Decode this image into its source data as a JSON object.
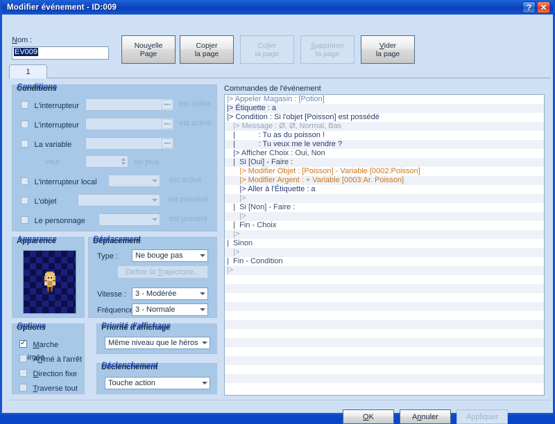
{
  "window": {
    "title": "Modifier événement - ID:009",
    "help_button": "?",
    "close_button": "✕"
  },
  "name_section": {
    "label": "Nom :",
    "label_mnemonic": "N",
    "value": "EV009"
  },
  "page_buttons": [
    {
      "line1": "Nouvelle",
      "line2": "Page",
      "mnemonic": "v",
      "enabled": true
    },
    {
      "line1": "Copier",
      "line2": "la page",
      "mnemonic": "i",
      "enabled": true
    },
    {
      "line1": "Coller",
      "line2": "la page",
      "mnemonic": "l",
      "enabled": false
    },
    {
      "line1": "Supprimer",
      "line2": "la page",
      "mnemonic": "S",
      "enabled": false
    },
    {
      "line1": "Vider",
      "line2": "la page",
      "mnemonic": "V",
      "enabled": true
    }
  ],
  "tabs": [
    {
      "label": "1",
      "selected": true
    }
  ],
  "conditions": {
    "title": "Conditions",
    "rows": [
      {
        "checkbox_label": "L'interrupteur",
        "checked": false,
        "field_value": "",
        "suffix": "est activé",
        "widget": "field-ellipsis"
      },
      {
        "checkbox_label": "L'interrupteur",
        "checked": false,
        "field_value": "",
        "suffix": "est activé",
        "widget": "field-ellipsis"
      },
      {
        "checkbox_label": "La variable",
        "checked": false,
        "field_value": "",
        "suffix": "",
        "widget": "field-ellipsis"
      },
      {
        "checkbox_label": "",
        "checked": null,
        "prefix": "vaut",
        "field_value": "",
        "suffix": "ou plus",
        "widget": "spinner"
      },
      {
        "checkbox_label": "L'interrupteur local",
        "checked": false,
        "field_value": "",
        "suffix": "est activé",
        "widget": "combo"
      },
      {
        "checkbox_label": "L'objet",
        "checked": false,
        "field_value": "",
        "suffix": "est possédé",
        "widget": "combo"
      },
      {
        "checkbox_label": "Le personnage",
        "checked": false,
        "field_value": "",
        "suffix": "est présent",
        "widget": "combo"
      }
    ]
  },
  "appearance": {
    "title": "Apparence"
  },
  "movement": {
    "title": "Déplacement",
    "type_label": "Type :",
    "type_value": "Ne bouge pas",
    "route_button": "Définir la Trajectoire...",
    "route_button_mnemonic": "T",
    "route_button_enabled": false,
    "speed_label": "Vitesse :",
    "speed_value": "3 - Modérée",
    "frequency_label": "Fréquence :",
    "frequency_value": "3 - Normale"
  },
  "options": {
    "title": "Options",
    "items": [
      {
        "label": "Marche animée",
        "mnemonic": "M",
        "checked": true
      },
      {
        "label": "Animé à l'arrêt",
        "mnemonic": "n",
        "checked": false
      },
      {
        "label": "Direction fixe",
        "mnemonic": "D",
        "checked": false
      },
      {
        "label": "Traverse tout",
        "mnemonic": "T",
        "checked": false
      }
    ]
  },
  "display_priority": {
    "title": "Priorité d'affichage",
    "value": "Même niveau que le héros"
  },
  "trigger": {
    "title": "Déclenchement",
    "value": "Touche action"
  },
  "commands": {
    "label": "Commandes de l'événement",
    "rows": [
      {
        "text": "|> Appeler Magasin : [Potion]",
        "color": "c-blue"
      },
      {
        "text": "|> Étiquette : a",
        "color": "c-navy"
      },
      {
        "text": "|> Condition : Si l'objet [Poisson] est possédé",
        "color": "c-navy"
      },
      {
        "text": "   |> Message : Ø, Ø, Normal, Bas",
        "color": "c-grey"
      },
      {
        "text": "   |           : Tu as du poisson !",
        "color": "c-navy"
      },
      {
        "text": "   |           : Tu veux me le vendre ?",
        "color": "c-navy"
      },
      {
        "text": "   |> Afficher Choix : Oui, Non",
        "color": "c-dark"
      },
      {
        "text": "   |  Si [Oui] - Faire :",
        "color": "c-dark"
      },
      {
        "text": "      |> Modifier Objet : [Poisson] - Variable [0002:Poisson]",
        "color": "c-orange"
      },
      {
        "text": "      |> Modifier Argent : + Variable [0003:Ar. Poisson]",
        "color": "c-orange"
      },
      {
        "text": "      |> Aller à l'Étiquette : a",
        "color": "c-navy"
      },
      {
        "text": "      |>",
        "color": "c-grey"
      },
      {
        "text": "   |  Si [Non] - Faire :",
        "color": "c-dark"
      },
      {
        "text": "      |>",
        "color": "c-grey"
      },
      {
        "text": "   |  Fin - Choix",
        "color": "c-dark"
      },
      {
        "text": "   |>",
        "color": "c-grey"
      },
      {
        "text": "|  Sinon",
        "color": "c-dark"
      },
      {
        "text": "   |>",
        "color": "c-grey"
      },
      {
        "text": "|  Fin - Condition",
        "color": "c-dark"
      },
      {
        "text": "|>",
        "color": "c-grey"
      }
    ]
  },
  "dialog_buttons": [
    {
      "label": "OK",
      "mnemonic": "O",
      "enabled": true
    },
    {
      "label": "Annuler",
      "mnemonic": "n",
      "enabled": true
    },
    {
      "label": "Appliquer",
      "mnemonic": "A",
      "enabled": false
    }
  ]
}
